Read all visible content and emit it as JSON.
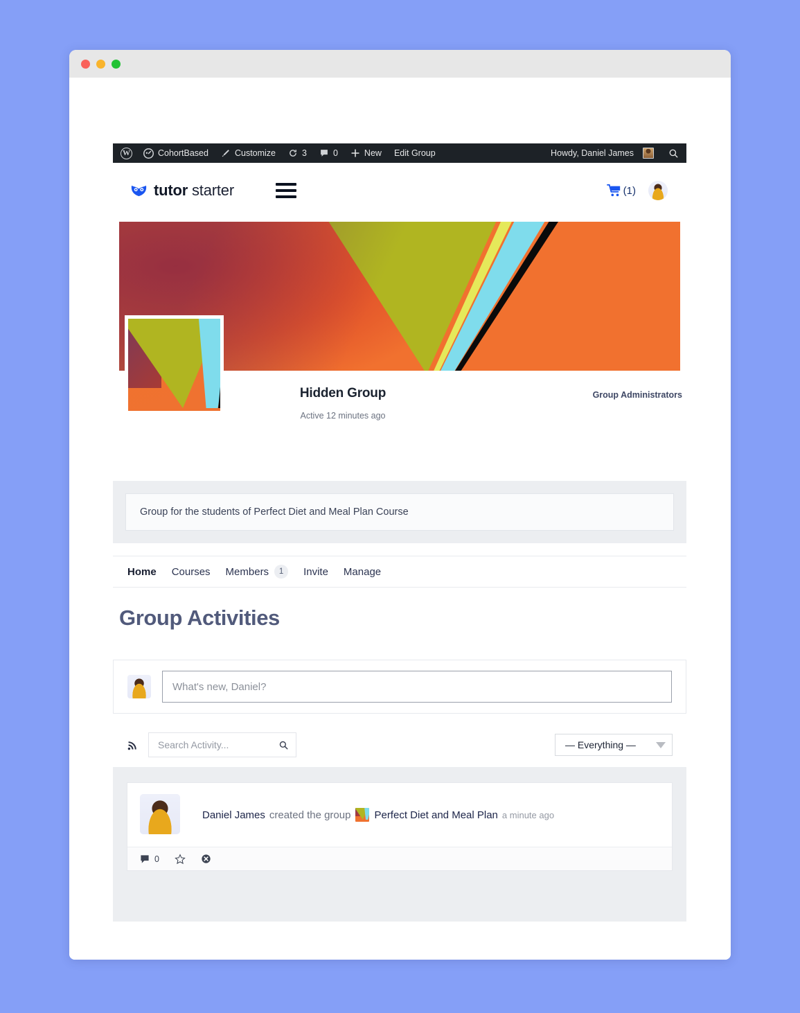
{
  "browser": {
    "traffic_lights": [
      "close",
      "minimize",
      "maximize"
    ]
  },
  "adminbar": {
    "wp_logo": "wordpress-logo-icon",
    "site_name": "CohortBased",
    "customize": "Customize",
    "updates_count": "3",
    "comments_count": "0",
    "new": "New",
    "edit_group": "Edit Group",
    "howdy": "Howdy, Daniel James",
    "search_icon": "search-icon"
  },
  "siteheader": {
    "logo_bold": "tutor",
    "logo_light": " starter",
    "menu_icon": "hamburger-menu-icon",
    "cart_icon": "cart-icon",
    "cart_count": "(1)",
    "avatar": "user-avatar"
  },
  "group": {
    "title": "Hidden Group",
    "active": "Active 12 minutes ago",
    "admins_label": "Group Administrators",
    "description": "Group for the students of Perfect Diet and Meal Plan Course"
  },
  "tabs": [
    {
      "label": "Home",
      "badge": null,
      "active": true
    },
    {
      "label": "Courses",
      "badge": null,
      "active": false
    },
    {
      "label": "Members",
      "badge": "1",
      "active": false
    },
    {
      "label": "Invite",
      "badge": null,
      "active": false
    },
    {
      "label": "Manage",
      "badge": null,
      "active": false
    }
  ],
  "main": {
    "page_title": "Group Activities",
    "post_placeholder": "What's new, Daniel?",
    "rss_icon": "rss-icon",
    "search_placeholder": "Search Activity...",
    "search_icon": "search-icon",
    "filter_selected": "— Everything —",
    "filter_caret": "chevron-down-icon"
  },
  "activity": {
    "user": "Daniel James",
    "action": "created the group",
    "group_icon": "group-avatar-icon",
    "group_name": "Perfect Diet and Meal Plan",
    "timestamp": "a minute ago",
    "comment_count": "0",
    "comment_icon": "comment-icon",
    "favorite_icon": "star-icon",
    "delete_icon": "delete-circle-icon"
  },
  "colors": {
    "page_background": "#859ff7",
    "adminbar": "#1d2227",
    "brand_blue": "#1d4ed8",
    "heading": "#515a7b"
  }
}
